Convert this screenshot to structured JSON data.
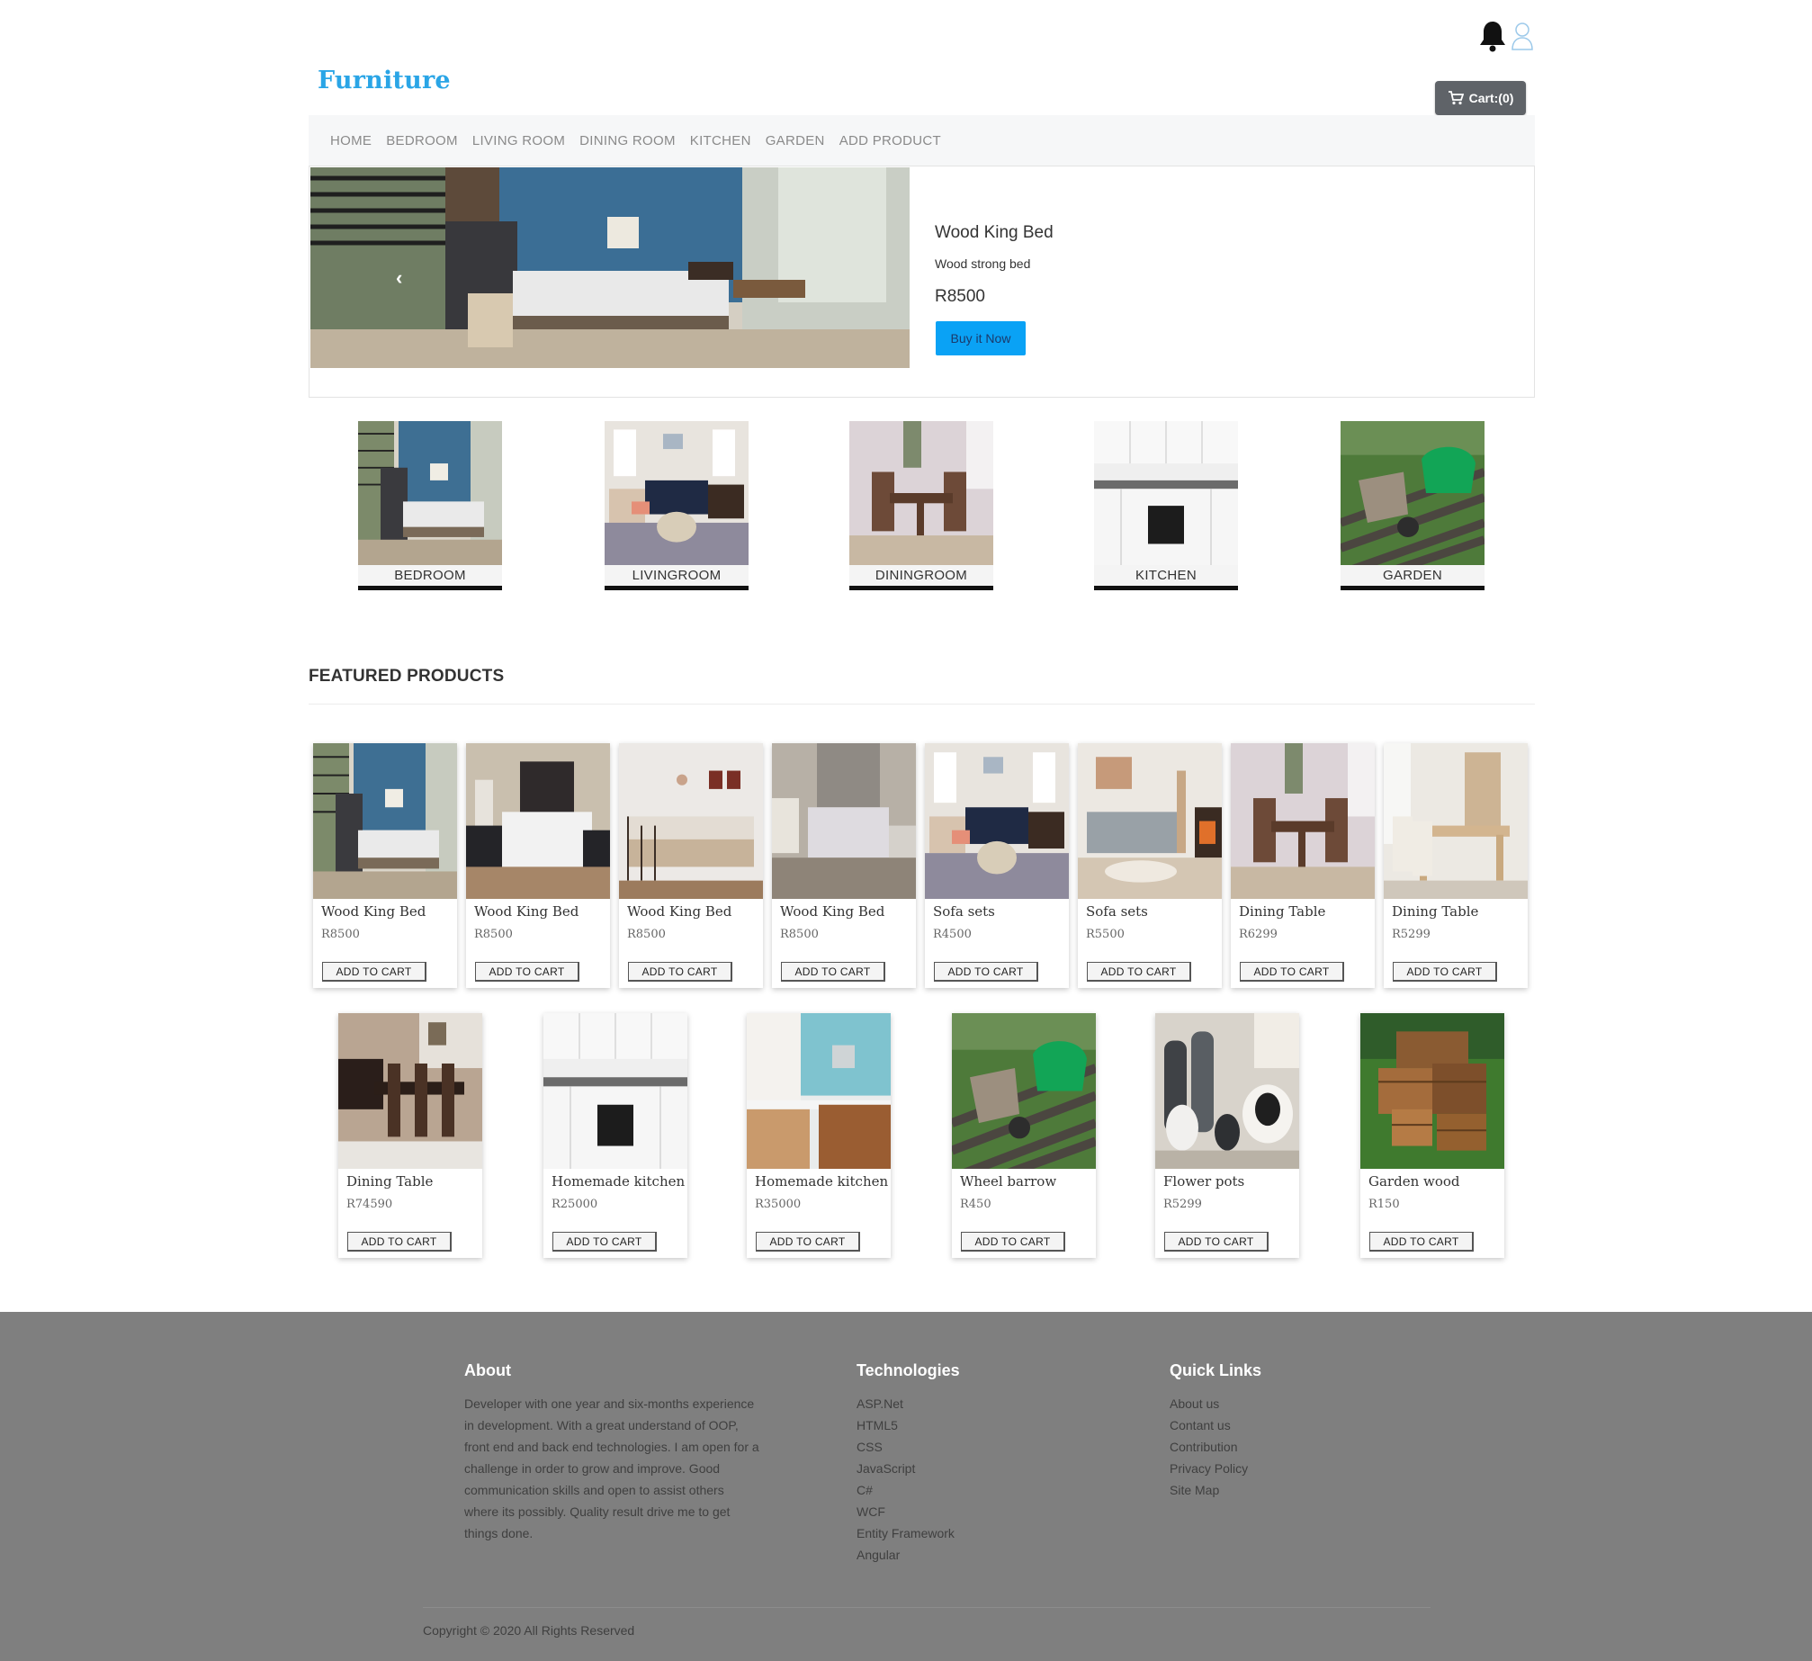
{
  "header": {
    "brand": "Furniture",
    "cart_label": "Cart:(0)",
    "icons": [
      "bell-icon",
      "user-icon",
      "cart-icon"
    ]
  },
  "nav": {
    "items": [
      "HOME",
      "BEDROOM",
      "LIVING ROOM",
      "DINING ROOM",
      "KITCHEN",
      "GARDEN",
      "ADD PRODUCT"
    ]
  },
  "hero": {
    "title": "Wood King Bed",
    "description": "Wood strong bed",
    "price": "R8500",
    "button_label": "Buy it Now"
  },
  "categories": [
    "BEDROOM",
    "LIVINGROOM",
    "DININGROOM",
    "KITCHEN",
    "GARDEN"
  ],
  "featured": {
    "heading": "FEATURED PRODUCTS",
    "button_label": "ADD TO CART",
    "products": [
      {
        "name": "Wood King Bed",
        "price": "R8500"
      },
      {
        "name": "Wood King Bed",
        "price": "R8500"
      },
      {
        "name": "Wood King Bed",
        "price": "R8500"
      },
      {
        "name": "Wood King Bed",
        "price": "R8500"
      },
      {
        "name": "Sofa sets",
        "price": "R4500"
      },
      {
        "name": "Sofa sets",
        "price": "R5500"
      },
      {
        "name": "Dining Table",
        "price": "R6299"
      },
      {
        "name": "Dining Table",
        "price": "R5299"
      },
      {
        "name": "Dining Table",
        "price": "R74590"
      },
      {
        "name": "Homemade kitchen",
        "price": "R25000"
      },
      {
        "name": "Homemade kitchen",
        "price": "R35000"
      },
      {
        "name": "Wheel barrow",
        "price": "R450"
      },
      {
        "name": "Flower pots",
        "price": "R5299"
      },
      {
        "name": "Garden wood",
        "price": "R150"
      }
    ]
  },
  "footer": {
    "about": {
      "heading": "About",
      "text": "Developer with one year and six-months experience in development. With a great understand of OOP, front end and back end technologies. I am open for a challenge in order to grow and improve. Good communication skills and open to assist others where its possibly. Quality result drive me to get things done."
    },
    "technologies": {
      "heading": "Technologies",
      "items": [
        "ASP.Net",
        "HTML5",
        "CSS",
        "JavaScript",
        "C#",
        "WCF",
        "Entity Framework",
        "Angular"
      ]
    },
    "quick_links": {
      "heading": "Quick Links",
      "items": [
        "About us",
        "Contant us",
        "Contribution",
        "Privacy Policy",
        "Site Map"
      ]
    },
    "copyright": "Copyright © 2020 All Rights Reserved"
  }
}
